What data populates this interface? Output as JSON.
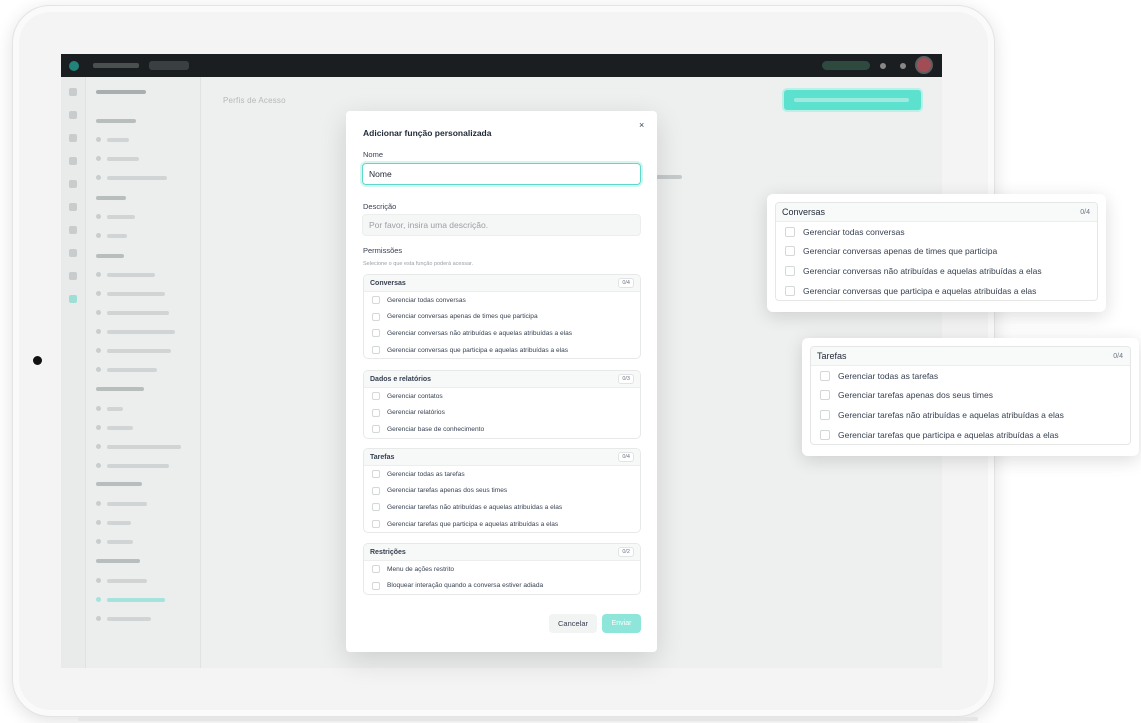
{
  "app": {
    "page_title": "Perfis de Acesso"
  },
  "modal": {
    "title": "Adicionar função personalizada",
    "close_glyph": "×",
    "name_label": "Nome",
    "name_value": "Nome",
    "description_label": "Descrição",
    "description_placeholder": "Por favor, insira uma descrição.",
    "permissions_label": "Permissões",
    "permissions_hint": "Selecione o que esta função poderá acessar.",
    "groups": [
      {
        "title": "Conversas",
        "count": "0/4",
        "items": [
          "Gerenciar todas conversas",
          "Gerenciar conversas apenas de times que participa",
          "Gerenciar conversas não atribuídas e aquelas atribuídas a elas",
          "Gerenciar conversas que participa e aquelas atribuídas a elas"
        ]
      },
      {
        "title": "Dados e relatórios",
        "count": "0/3",
        "items": [
          "Gerenciar contatos",
          "Gerenciar relatórios",
          "Gerenciar base de conhecimento"
        ]
      },
      {
        "title": "Tarefas",
        "count": "0/4",
        "items": [
          "Gerenciar todas as tarefas",
          "Gerenciar tarefas apenas dos seus times",
          "Gerenciar tarefas não atribuídas e aquelas atribuídas a elas",
          "Gerenciar tarefas que participa e aquelas atribuídas a elas"
        ]
      },
      {
        "title": "Restrições",
        "count": "0/2",
        "items": [
          "Menu de ações restrito",
          "Bloquear interação quando a conversa estiver adiada"
        ]
      }
    ],
    "cancel_label": "Cancelar",
    "submit_label": "Enviar"
  },
  "callouts": [
    {
      "title": "Conversas",
      "count": "0/4",
      "items": [
        "Gerenciar todas conversas",
        "Gerenciar conversas apenas de times que participa",
        "Gerenciar conversas não atribuídas e aquelas atribuídas a elas",
        "Gerenciar conversas que participa e aquelas atribuídas a elas"
      ]
    },
    {
      "title": "Tarefas",
      "count": "0/4",
      "items": [
        "Gerenciar todas as tarefas",
        "Gerenciar tarefas apenas dos seus times",
        "Gerenciar tarefas não atribuídas e aquelas atribuídas a elas",
        "Gerenciar tarefas que participa e aquelas atribuídas a elas"
      ]
    }
  ],
  "colors": {
    "accent": "#5ce1cf",
    "topbar": "#1b1e20",
    "submit_disabled": "#8ee6db"
  }
}
